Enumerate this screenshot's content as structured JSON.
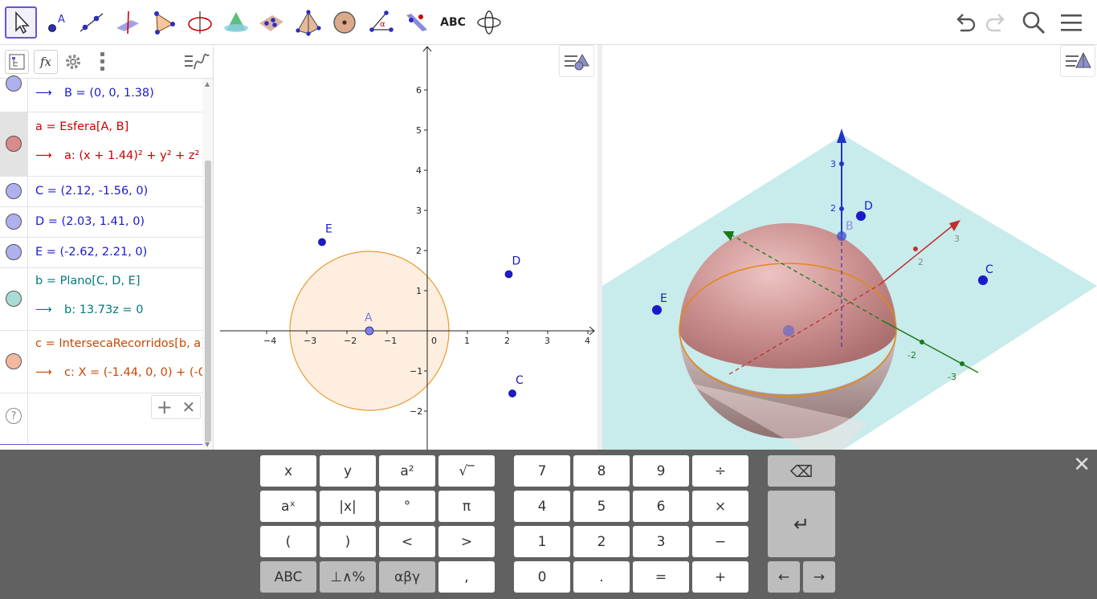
{
  "toolbar": {
    "tools": [
      "move-tool",
      "point-tool",
      "line-tool",
      "perpendicular-tool",
      "polygon-tool",
      "circle-tool",
      "intersect-surfaces-tool",
      "plane-through-3-points-tool",
      "pyramid-tool",
      "sphere-tool",
      "angle-tool",
      "reflect-tool",
      "text-tool",
      "rotate-view-tool"
    ],
    "text_tool_label": "ABC",
    "point_tool_label": "A",
    "angle_tool_label": "α"
  },
  "algebra": {
    "toolbar": {
      "formula_label": "fx"
    },
    "rows": [
      {
        "line2": "B = (0, 0, 1.38)",
        "color": "#1a1acc",
        "dot": "#a9a9f0"
      },
      {
        "line1": "a = Esfera[A, B]",
        "line2": "a: (x + 1.44)² + y² + z² =",
        "color": "#cc0000",
        "dot": "#d97c7c"
      },
      {
        "line1": "C = (2.12, -1.56, 0)",
        "color": "#1a1acc",
        "dot": "#a9a9f0"
      },
      {
        "line1": "D = (2.03, 1.41, 0)",
        "color": "#1a1acc",
        "dot": "#a9a9f0"
      },
      {
        "line1": "E = (-2.62, 2.21, 0)",
        "color": "#1a1acc",
        "dot": "#a9a9f0"
      },
      {
        "line1": "b = Plano[C, D, E]",
        "line2": "b: 13.73z = 0",
        "color": "#007a7a",
        "dot": "#a7d8d8"
      },
      {
        "line1": "c = IntersecaRecorridos[b, a]",
        "line2": "c: X = (-1.44, 0, 0) + (-0.",
        "color": "#cc4400",
        "dot": "#f0b49a"
      }
    ],
    "arrow": "⟶",
    "help": "?"
  },
  "graphics2d": {
    "x_ticks": [
      "−4",
      "−3",
      "−2",
      "−1",
      "0",
      "1",
      "2",
      "3",
      "4"
    ],
    "y_ticks": [
      "6",
      "5",
      "4",
      "3",
      "2",
      "1",
      "0",
      "−1",
      "−2"
    ],
    "points": [
      {
        "label": "A",
        "x": -1.44,
        "y": 0
      },
      {
        "label": "C",
        "x": 2.12,
        "y": -1.56
      },
      {
        "label": "D",
        "x": 2.03,
        "y": 1.41
      },
      {
        "label": "E",
        "x": -2.62,
        "y": 2.21
      }
    ],
    "circle": {
      "center": [
        -1.44,
        0
      ],
      "radius": 1.98,
      "stroke": "#e69a2e",
      "fill": "#fdeee0"
    }
  },
  "graphics3d": {
    "labels": {
      "B": "B",
      "C": "C",
      "D": "D",
      "E": "E"
    },
    "z_ticks": [
      "3",
      "2"
    ],
    "y_ticks": [
      "2",
      "3"
    ],
    "x_ticks": [
      "-2",
      "-3"
    ]
  },
  "keyboard": {
    "keys_left": [
      "x",
      "y",
      "a²",
      "√‾",
      "aˣ",
      "|x|",
      "°",
      "π",
      "(",
      ")",
      "<",
      ">",
      "ABC",
      "⊥∧%",
      "αβγ",
      ","
    ],
    "keys_num": [
      "7",
      "8",
      "9",
      "÷",
      "4",
      "5",
      "6",
      "×",
      "1",
      "2",
      "3",
      "−",
      "0",
      ".",
      "=",
      "+"
    ],
    "backspace": "⌫",
    "enter": "↵",
    "left": "←",
    "right": "→",
    "close": "✕"
  }
}
